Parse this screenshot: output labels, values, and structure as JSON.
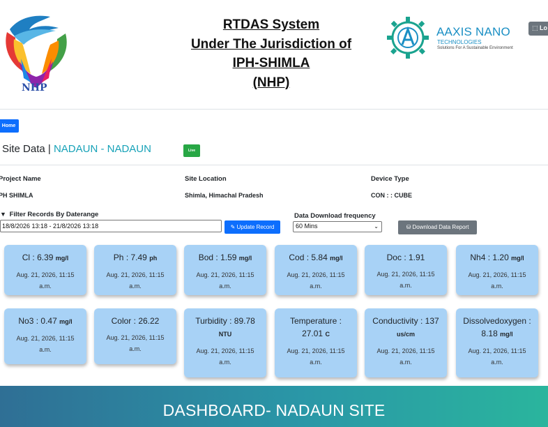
{
  "header": {
    "nhp_logo_text": "NHP",
    "title_lines": [
      "RTDAS System",
      "Under The Jurisdiction of",
      "IPH-SHIMLA",
      "(NHP)"
    ],
    "aaxis_name": "AAXIS NANO",
    "aaxis_sub1": "TECHNOLOGIES",
    "aaxis_sub2": "Solutions For A Sustainable Environment",
    "logout_label": "Lo"
  },
  "nav": {
    "home_label": "Home"
  },
  "site": {
    "label_prefix": "Site Data |",
    "name": "NADAUN - NADAUN",
    "live_label": "Live"
  },
  "info": {
    "project_name_label": "Project Name",
    "project_name_value": "PH SHIMLA",
    "site_location_label": "Site Location",
    "site_location_value": "Shimla, Himachal Pradesh",
    "device_type_label": "Device Type",
    "device_type_value": "CON : : CUBE"
  },
  "filter": {
    "label": "Filter Records By Daterange",
    "daterange_value": "18/8/2026 13:18 - 21/8/2026 13:18",
    "update_label": "Update Record",
    "freq_label": "Data Download frequency",
    "freq_selected": "60 Mins",
    "download_label": "Download Data Report"
  },
  "readings": [
    {
      "name": "Cl",
      "value": "6.39",
      "unit": "mg/l",
      "time": "Aug. 21, 2026, 11:15 a.m."
    },
    {
      "name": "Ph",
      "value": "7.49",
      "unit": "ph",
      "time": "Aug. 21, 2026, 11:15 a.m."
    },
    {
      "name": "Bod",
      "value": "1.59",
      "unit": "mg/l",
      "time": "Aug. 21, 2026, 11:15 a.m."
    },
    {
      "name": "Cod",
      "value": "5.84",
      "unit": "mg/l",
      "time": "Aug. 21, 2026, 11:15 a.m."
    },
    {
      "name": "Doc",
      "value": "1.91",
      "unit": "",
      "time": "Aug. 21, 2026, 11:15 a.m."
    },
    {
      "name": "Nh4",
      "value": "1.20",
      "unit": "mg/l",
      "time": "Aug. 21, 2026, 11:15 a.m."
    },
    {
      "name": "No3",
      "value": "0.47",
      "unit": "mg/l",
      "time": "Aug. 21, 2026, 11:15 a.m."
    },
    {
      "name": "Color",
      "value": "26.22",
      "unit": "",
      "time": "Aug. 21, 2026, 11:15 a.m."
    },
    {
      "name": "Turbidity",
      "value": "89.78",
      "unit": "NTU",
      "time": "Aug. 21, 2026, 11:15 a.m."
    },
    {
      "name": "Temperature",
      "value": "27.01",
      "unit": "C",
      "time": "Aug. 21, 2026, 11:15 a.m."
    },
    {
      "name": "Conductivity",
      "value": "137",
      "unit": "us/cm",
      "time": "Aug. 21, 2026, 11:15 a.m."
    },
    {
      "name": "Dissolvedoxygen",
      "value": "8.18",
      "unit": "mg/l",
      "time": "Aug. 21, 2026, 11:15 a.m."
    }
  ],
  "footer": {
    "title": "DASHBOARD-  NADAUN SITE"
  },
  "colors": {
    "primary": "#0d6efd",
    "card_bg": "#a8d2f6",
    "live": "#28a745",
    "site_name": "#17a2b8",
    "secondary": "#6c757d"
  }
}
